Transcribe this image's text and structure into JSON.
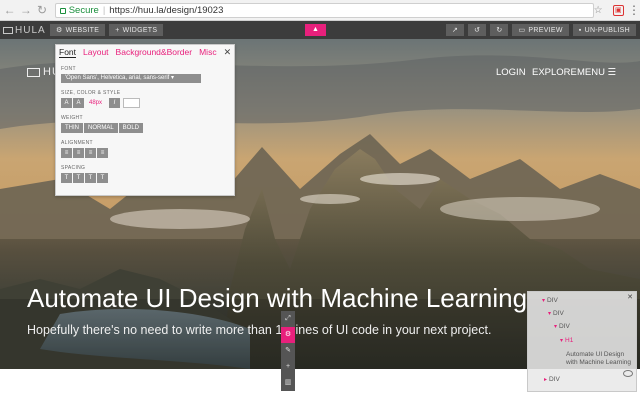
{
  "browser": {
    "secure_label": "Secure",
    "url": "https://huu.la/design/19023"
  },
  "toolbar": {
    "logo": "HULA",
    "website_label": "WEBSITE",
    "widgets_label": "WIDGETS",
    "preview_label": "PREVIEW",
    "unpublish_label": "UN-PUBLISH"
  },
  "site": {
    "logo": "HUULA",
    "nav": [
      "LOGIN",
      "EXPLORE",
      "MENU"
    ],
    "title": "Automate UI Design with Machine Learning",
    "subtitle": "Hopefully there's no need to write more than 10 lines of UI code in your next project."
  },
  "style_panel": {
    "tabs": [
      "Font",
      "Layout",
      "Background&Border",
      "Misc"
    ],
    "active_tab": "Font",
    "font_label": "FONT",
    "font_value": "'Open Sans', Helvetica, arial, sans-serif",
    "size_label": "SIZE, COLOR & STYLE",
    "size_value": "48px",
    "weight_label": "WEIGHT",
    "weights": [
      "THIN",
      "NORMAL",
      "BOLD"
    ],
    "alignment_label": "ALIGNMENT",
    "spacing_label": "SPACING"
  },
  "tree": {
    "nodes": [
      "DIV",
      "DIV",
      "DIV",
      "H1",
      "Automate UI Design with Machine Learning",
      "DIV"
    ]
  },
  "colors": {
    "accent": "#e8207c",
    "toolbar_bg": "#3c3c3c"
  }
}
